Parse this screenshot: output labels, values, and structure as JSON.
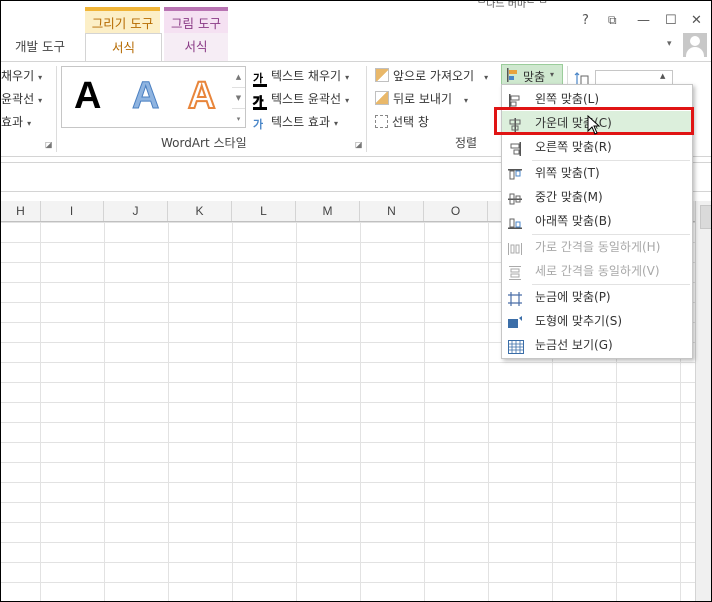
{
  "tabs": {
    "contextual_drawing": "그리기 도구",
    "contextual_picture": "그림 도구",
    "developer": "개발 도구",
    "format_drawing": "서식",
    "format_picture": "서식",
    "partial_text": "ᄇ나느 버마ᄃ ᄆ"
  },
  "window_controls": {
    "help": "?",
    "restore_ribbon": "⧉",
    "minimize": "—",
    "maximize": "☐",
    "close": "✕",
    "collapse": "⌃"
  },
  "shape_styles": {
    "fill": "채우기",
    "outline": "윤곽선",
    "effects": "효과"
  },
  "wordart": {
    "letters": [
      "A",
      "A",
      "A"
    ],
    "text_fill": "텍스트 채우기",
    "text_outline": "텍스트 윤곽선",
    "text_effects": "텍스트 효과",
    "group_label": "WordArt 스타일"
  },
  "arrange": {
    "bring_forward": "앞으로 가져오기",
    "send_backward": "뒤로 보내기",
    "selection_pane": "선택 창",
    "align": "맞춤",
    "group_label": "정렬"
  },
  "columns": [
    "H",
    "I",
    "J",
    "K",
    "L",
    "M",
    "N",
    "O"
  ],
  "align_menu": {
    "items": [
      {
        "label": "왼쪽 맞춤(L)",
        "icon": "align-left-icon",
        "enabled": true
      },
      {
        "label": "가운데 맞춤(C)",
        "icon": "align-center-icon",
        "enabled": true
      },
      {
        "label": "오른쪽 맞춤(R)",
        "icon": "align-right-icon",
        "enabled": true
      },
      {
        "label": "위쪽 맞춤(T)",
        "icon": "align-top-icon",
        "enabled": true
      },
      {
        "label": "중간 맞춤(M)",
        "icon": "align-middle-icon",
        "enabled": true
      },
      {
        "label": "아래쪽 맞춤(B)",
        "icon": "align-bottom-icon",
        "enabled": true
      },
      {
        "label": "가로 간격을 동일하게(H)",
        "icon": "distribute-horizontal-icon",
        "enabled": false
      },
      {
        "label": "세로 간격을 동일하게(V)",
        "icon": "distribute-vertical-icon",
        "enabled": false
      },
      {
        "label": "눈금에 맞춤(P)",
        "icon": "snap-to-grid-icon",
        "enabled": true
      },
      {
        "label": "도형에 맞추기(S)",
        "icon": "snap-to-shape-icon",
        "enabled": true
      },
      {
        "label": "눈금선 보기(G)",
        "icon": "view-gridlines-icon",
        "enabled": true
      }
    ],
    "highlighted_index": 1
  },
  "colors": {
    "highlight_box": "#e01414",
    "drawing_tools": "#f0b437",
    "picture_tools": "#b873b2",
    "hover_green": "#dcefdc"
  }
}
